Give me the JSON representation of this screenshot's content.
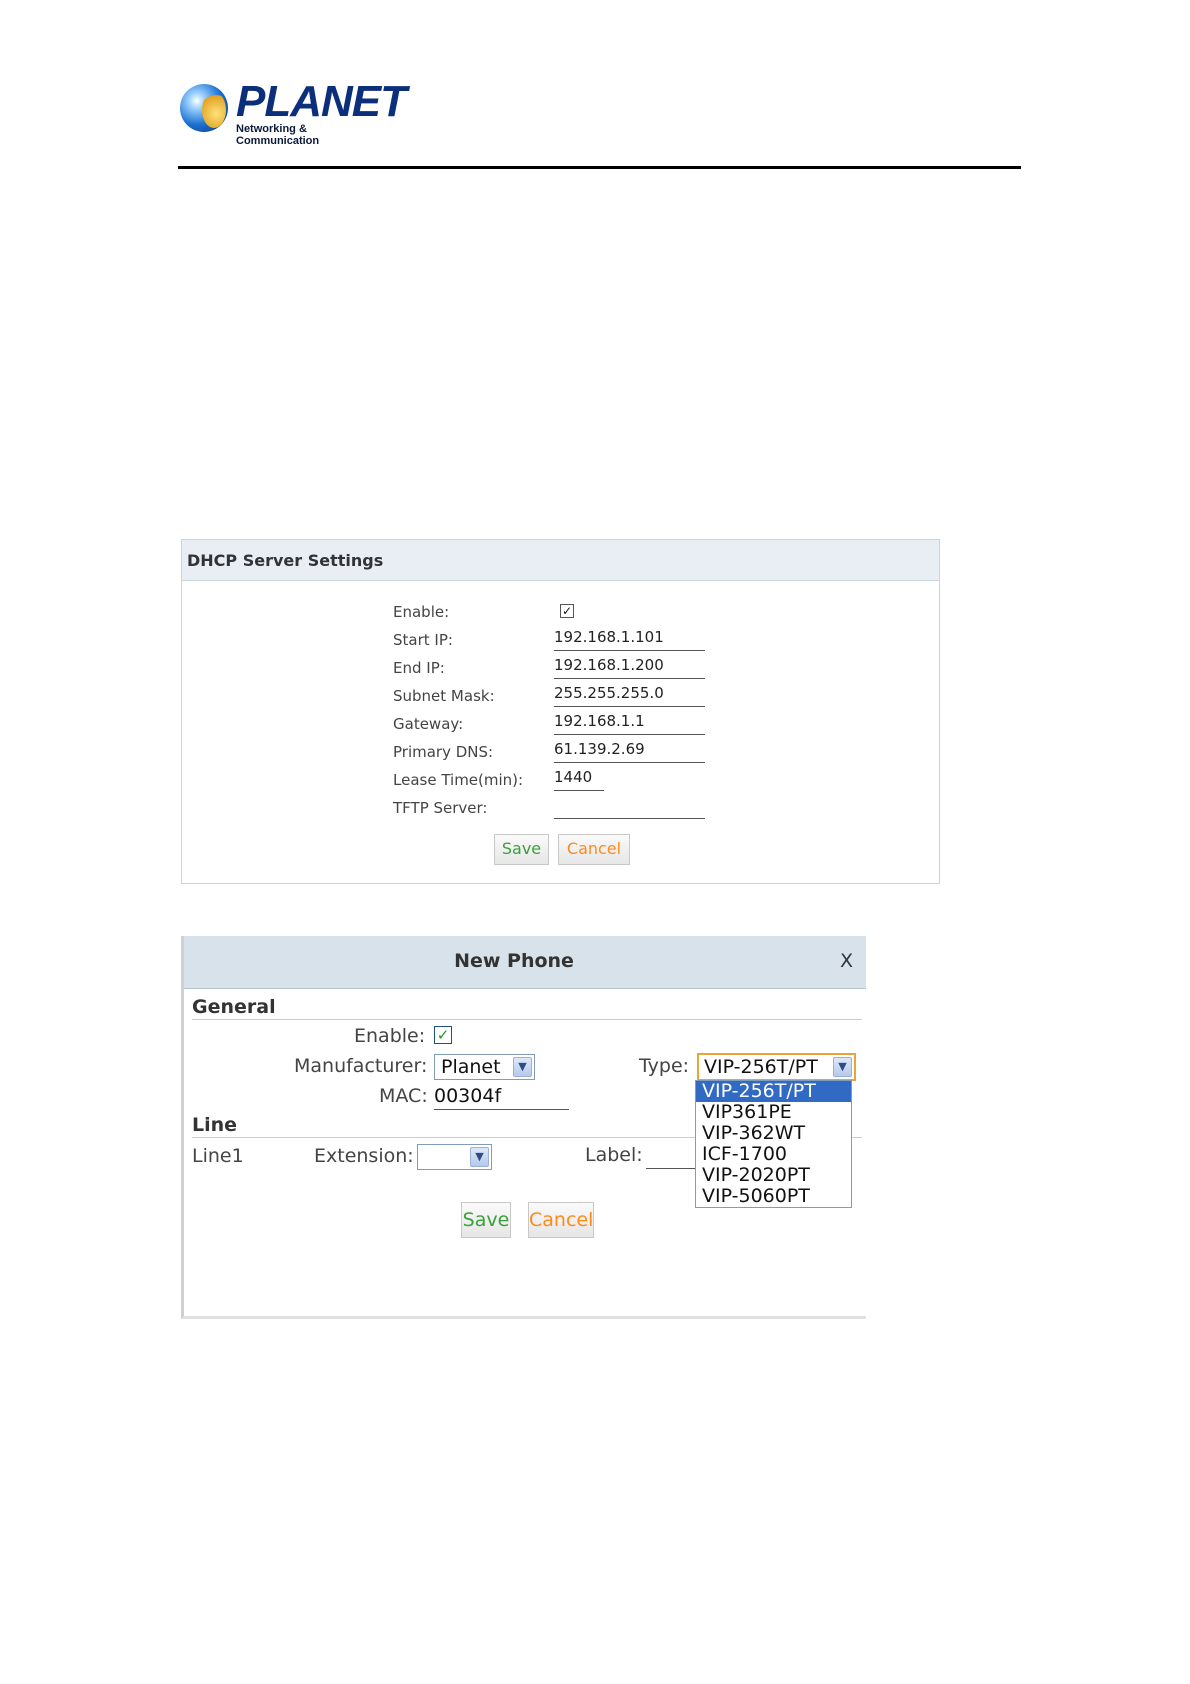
{
  "header": {
    "brand": "PLANET",
    "tagline": "Networking & Communication"
  },
  "dhcp": {
    "title": "DHCP Server Settings",
    "fields": [
      {
        "label": "Enable:",
        "type": "checkbox",
        "checked": true
      },
      {
        "label": "Start IP:",
        "value": "192.168.1.101"
      },
      {
        "label": "End IP:",
        "value": "192.168.1.200"
      },
      {
        "label": "Subnet Mask:",
        "value": "255.255.255.0"
      },
      {
        "label": "Gateway:",
        "value": "192.168.1.1"
      },
      {
        "label": "Primary DNS:",
        "value": "61.139.2.69"
      },
      {
        "label": "Lease Time(min):",
        "value": "1440"
      },
      {
        "label": "TFTP Server:",
        "value": ""
      }
    ],
    "save_label": "Save",
    "cancel_label": "Cancel"
  },
  "new_phone": {
    "title": "New Phone",
    "close_label": "X",
    "general_title": "General",
    "enable_label": "Enable:",
    "enable_checked": true,
    "manufacturer_label": "Manufacturer:",
    "manufacturer_value": "Planet",
    "type_label": "Type:",
    "type_value": "VIP-256T/PT",
    "type_options": [
      "VIP-256T/PT",
      "VIP361PE",
      "VIP-362WT",
      "ICF-1700",
      "VIP-2020PT",
      "VIP-5060PT"
    ],
    "mac_label": "MAC:",
    "mac_value": "00304f",
    "line_title": "Line",
    "line_name": "Line1",
    "extension_label": "Extension:",
    "extension_value": "",
    "label_label": "Label:",
    "label_value": "",
    "save_label": "Save",
    "cancel_label": "Cancel"
  },
  "colors": {
    "brand_blue": "#0b2f7a",
    "panel_header": "#e8eef3",
    "dialog_header": "#d8e2ea",
    "save_text": "#3aa03a",
    "cancel_text": "#ff8a1a",
    "selected_option": "#316ac5"
  }
}
